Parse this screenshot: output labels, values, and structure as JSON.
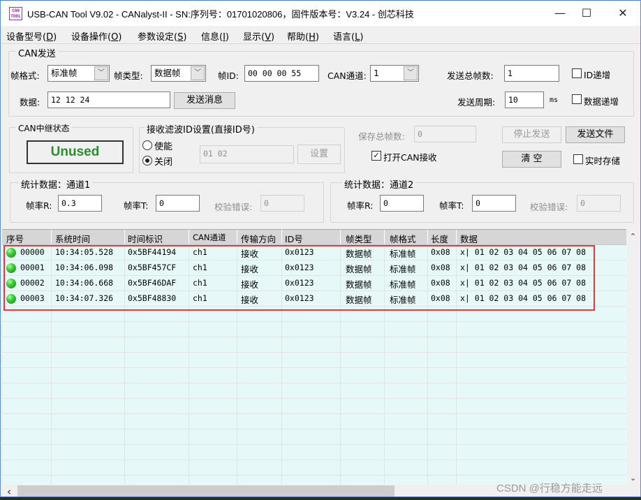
{
  "window": {
    "icon_text": [
      "CAN",
      "TOOL"
    ],
    "title": "USB-CAN Tool V9.02 - CANalyst-II - SN:序列号：01701020806，固件版本号：V3.24 - 创芯科技",
    "minimize": "—",
    "maximize": "☐",
    "close": "✕"
  },
  "menu": [
    {
      "label": "设备型号(",
      "key": "D",
      "end": ")"
    },
    {
      "label": "设备操作(",
      "key": "O",
      "end": ")"
    },
    {
      "label": "参数设定(",
      "key": "S",
      "end": ")"
    },
    {
      "label": "信息(",
      "key": "I",
      "end": ")"
    },
    {
      "label": "显示(",
      "key": "V",
      "end": ")"
    },
    {
      "label": "帮助(",
      "key": "H",
      "end": ")"
    },
    {
      "label": "语言(",
      "key": "L",
      "end": ")"
    }
  ],
  "can_send": {
    "title": "CAN发送",
    "frame_format_label": "帧格式:",
    "frame_format_value": "标准帧",
    "frame_type_label": "帧类型:",
    "frame_type_value": "数据帧",
    "frame_id_label": "帧ID:",
    "frame_id_value": "00 00 00 55",
    "can_channel_label": "CAN通道:",
    "can_channel_value": "1",
    "total_frames_label": "发送总帧数:",
    "total_frames_value": "1",
    "id_increment_label": "ID递增",
    "id_increment_checked": false,
    "data_label": "数据:",
    "data_value": "12 12 24",
    "send_button": "发送消息",
    "period_label": "发送周期:",
    "period_value": "10",
    "period_unit": "ms",
    "data_increment_label": "数据递增",
    "data_increment_checked": false
  },
  "relay": {
    "title": "CAN中继状态",
    "status": "Unused",
    "status_color": "#2e8b2e"
  },
  "filter": {
    "title": "接收滤波ID设置(直接ID号)",
    "enable_label": "使能",
    "disable_label": "关闭",
    "selected": "关闭",
    "id_value": "01 02",
    "set_button": "设置"
  },
  "controls": {
    "saved_frames_label": "保存总帧数:",
    "saved_frames_value": "0",
    "open_receive_label": "打开CAN接收",
    "open_receive_checked": true,
    "stop_send_button": "停止发送",
    "send_file_button": "发送文件",
    "clear_button": "清 空",
    "realtime_save_label": "实时存储",
    "realtime_save_checked": false
  },
  "stats": [
    {
      "title": "统计数据：通道1",
      "rate_r_label": "帧率R:",
      "rate_r": "0.3",
      "rate_t_label": "帧率T:",
      "rate_t": "0",
      "err_label": "校验错误:",
      "err": "0"
    },
    {
      "title": "统计数据：通道2",
      "rate_r_label": "帧率R:",
      "rate_r": "0",
      "rate_t_label": "帧率T:",
      "rate_t": "0",
      "err_label": "校验错误:",
      "err": "0"
    }
  ],
  "grid": {
    "columns": [
      "序号",
      "系统时间",
      "时间标识",
      "CAN通道",
      "传输方向",
      "ID号",
      "帧类型",
      "帧格式",
      "长度",
      "数据"
    ],
    "rows": [
      {
        "seq": "00000",
        "time": "10:34:05.528",
        "stamp": "0x5BF44194",
        "channel": "ch1",
        "dir": "接收",
        "id": "0x0123",
        "type": "数据帧",
        "format": "标准帧",
        "len": "0x08",
        "data": "x| 01 02 03 04 05 06 07 08"
      },
      {
        "seq": "00001",
        "time": "10:34:06.098",
        "stamp": "0x5BF457CF",
        "channel": "ch1",
        "dir": "接收",
        "id": "0x0123",
        "type": "数据帧",
        "format": "标准帧",
        "len": "0x08",
        "data": "x| 01 02 03 04 05 06 07 08"
      },
      {
        "seq": "00002",
        "time": "10:34:06.668",
        "stamp": "0x5BF46DAF",
        "channel": "ch1",
        "dir": "接收",
        "id": "0x0123",
        "type": "数据帧",
        "format": "标准帧",
        "len": "0x08",
        "data": "x| 01 02 03 04 05 06 07 08"
      },
      {
        "seq": "00003",
        "time": "10:34:07.326",
        "stamp": "0x5BF48830",
        "channel": "ch1",
        "dir": "接收",
        "id": "0x0123",
        "type": "数据帧",
        "format": "标准帧",
        "len": "0x08",
        "data": "x| 01 02 03 04 05 06 07 08"
      }
    ],
    "row_status_color": "#2ebd2e",
    "highlight_color": "#e8343a"
  },
  "scroll": {
    "up": "⌃",
    "down": "⌄",
    "left": "‹"
  },
  "watermark": "CSDN @行稳方能走远"
}
